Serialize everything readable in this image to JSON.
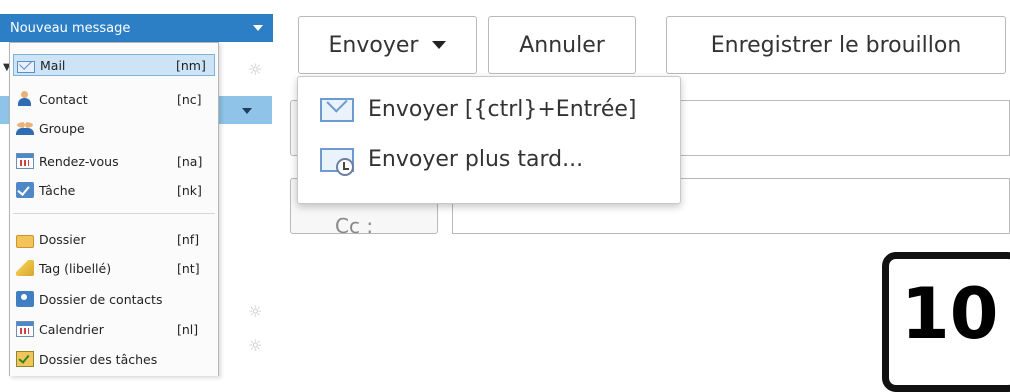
{
  "new_message": {
    "label": "Nouveau message"
  },
  "menu": {
    "items": [
      {
        "label": "Mail",
        "shortcut": "[nm]",
        "icon": "mail-icon",
        "selected": true
      },
      {
        "label": "Contact",
        "shortcut": "[nc]",
        "icon": "contact-icon"
      },
      {
        "label": "Groupe",
        "shortcut": "",
        "icon": "group-icon"
      },
      {
        "label": "Rendez-vous",
        "shortcut": "[na]",
        "icon": "calendar-icon"
      },
      {
        "label": "Tâche",
        "shortcut": "[nk]",
        "icon": "task-icon"
      },
      {
        "label": "Dossier",
        "shortcut": "[nf]",
        "icon": "folder-icon"
      },
      {
        "label": "Tag (libellé)",
        "shortcut": "[nt]",
        "icon": "tag-icon"
      },
      {
        "label": "Dossier de contacts",
        "shortcut": "",
        "icon": "contacts-folder-icon"
      },
      {
        "label": "Calendrier",
        "shortcut": "[nl]",
        "icon": "calendar-icon"
      },
      {
        "label": "Dossier des tâches",
        "shortcut": "",
        "icon": "tasks-folder-icon"
      }
    ]
  },
  "toolbar": {
    "send_label": "Envoyer",
    "cancel_label": "Annuler",
    "draft_label": "Enregistrer le brouillon"
  },
  "send_menu": {
    "send_now": "Envoyer [{ctrl}+Entrée]",
    "send_later": "Envoyer plus tard..."
  },
  "form": {
    "cc_label": "Cc :"
  },
  "step_badge": "10",
  "colors": {
    "accent": "#2d7fc5",
    "selection": "#cde4f7",
    "sidebar_selected": "#8fc3e7"
  }
}
